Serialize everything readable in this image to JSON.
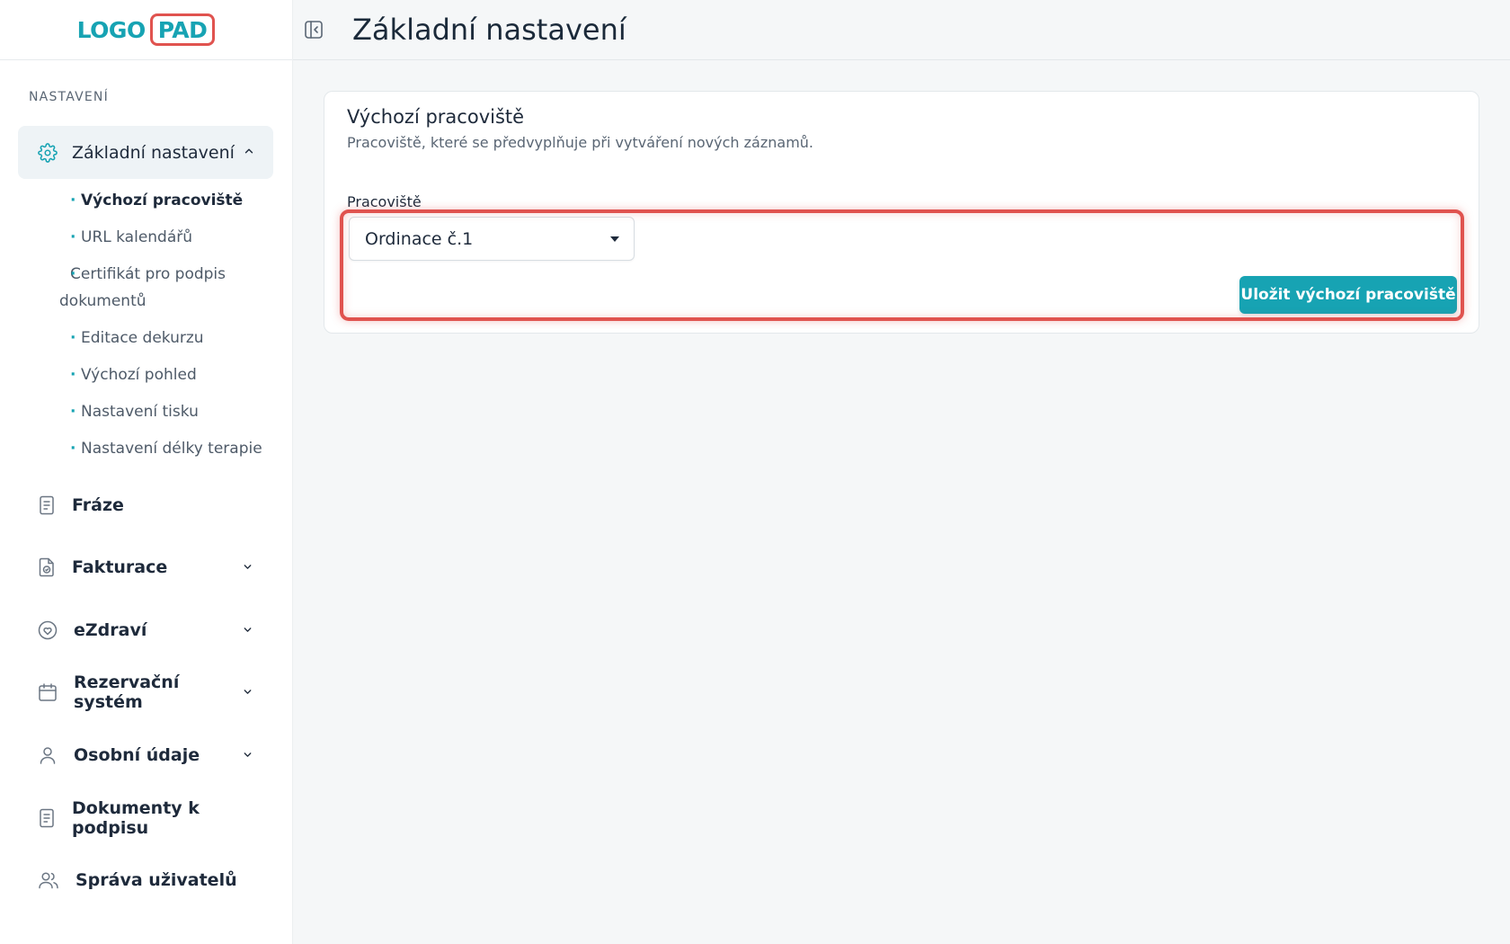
{
  "logo": {
    "part1": "LOGO",
    "part2": "PAD"
  },
  "sidebar": {
    "section_label": "NASTAVENÍ",
    "active_item": {
      "label": "Základní nastavení",
      "icon": "gear-icon"
    },
    "subitems": [
      {
        "label": "Výchozí pracoviště",
        "active": true
      },
      {
        "label": "URL kalendářů"
      },
      {
        "label": "Certifikát pro podpis dokumentů"
      },
      {
        "label": "Editace dekurzu"
      },
      {
        "label": "Výchozí pohled"
      },
      {
        "label": "Nastavení tisku"
      },
      {
        "label": "Nastavení délky terapie"
      }
    ],
    "items": [
      {
        "label": "Fráze",
        "icon": "document-icon"
      },
      {
        "label": "Fakturace",
        "icon": "invoice-icon"
      },
      {
        "label": "eZdraví",
        "icon": "heart-shield-icon"
      },
      {
        "label": "Rezervační systém",
        "icon": "calendar-icon"
      },
      {
        "label": "Osobní údaje",
        "icon": "user-icon"
      },
      {
        "label": "Dokumenty k podpisu",
        "icon": "document-icon"
      },
      {
        "label": "Správa uživatelů",
        "icon": "users-icon"
      }
    ]
  },
  "header": {
    "title": "Základní nastavení"
  },
  "card": {
    "title": "Výchozí pracoviště",
    "description": "Pracoviště, které se předvyplňuje při vytváření nových záznamů.",
    "field_label": "Pracoviště",
    "select_value": "Ordinace č.1",
    "save_label": "Uložit výchozí pracoviště"
  },
  "colors": {
    "accent": "#17a3b3",
    "highlight": "#e0534f",
    "text": "#1e2a3b"
  }
}
